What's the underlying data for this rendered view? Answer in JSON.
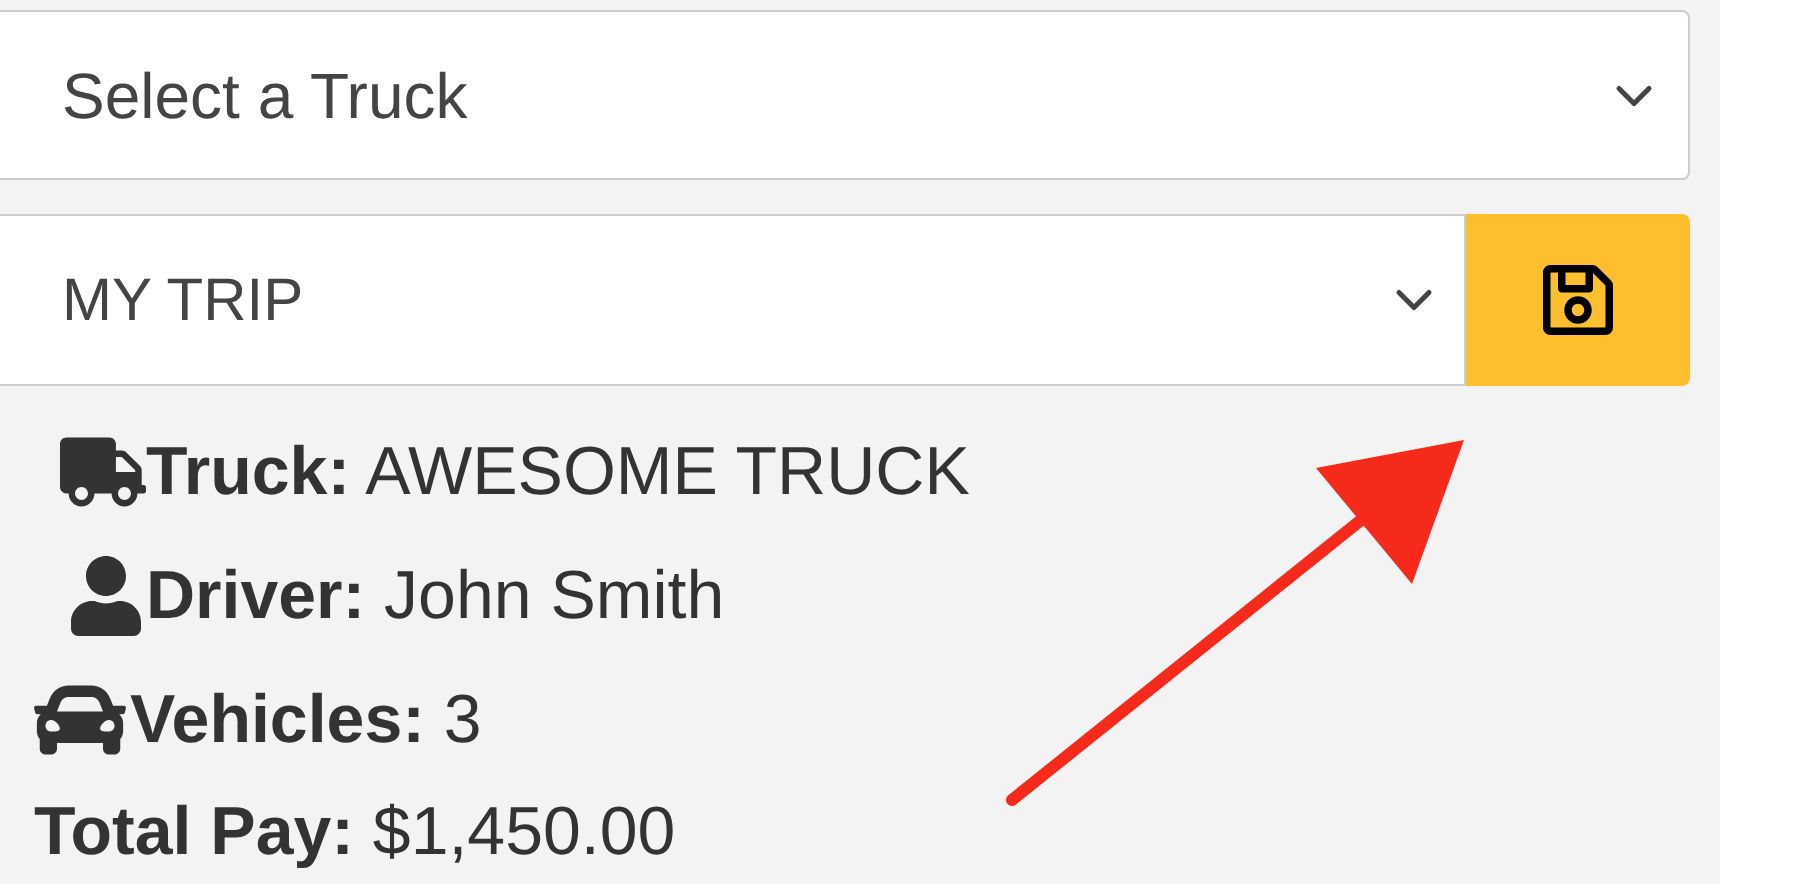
{
  "truck_select": {
    "value": "Select a Truck"
  },
  "trip_select": {
    "value": "MY TRIP"
  },
  "details": [
    {
      "kind": "truck",
      "text": "**Truck:** AWESOME TRUCK"
    },
    {
      "kind": "driver",
      "text": "**Driver:** John Smith"
    },
    {
      "kind": "vehicles",
      "text": "**Vehicles:** 3"
    },
    {
      "kind": "plain",
      "text": "**Total Pay:** $1,450.00"
    }
  ]
}
